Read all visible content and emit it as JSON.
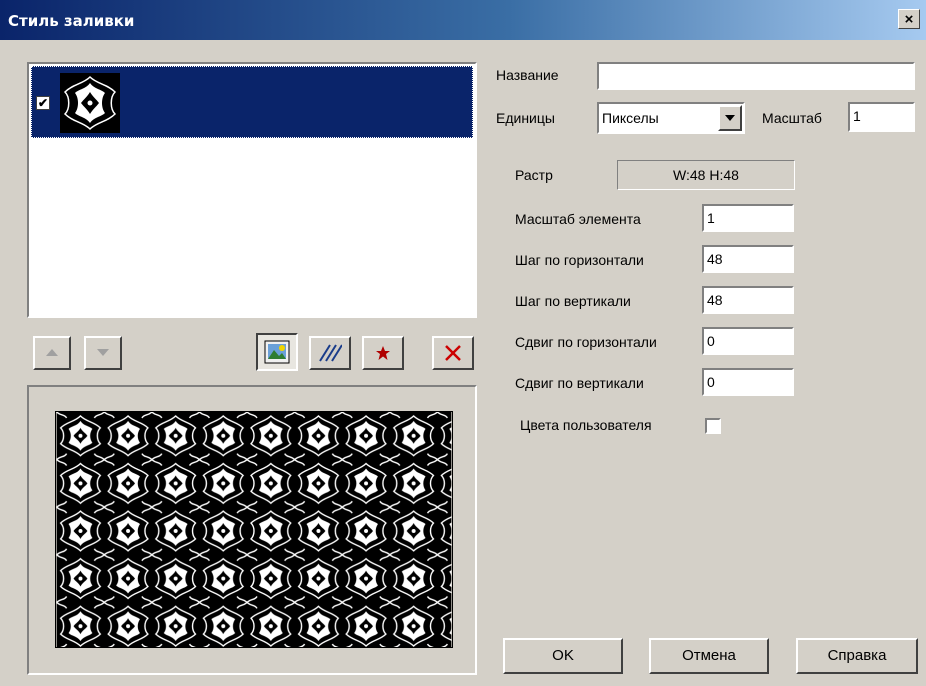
{
  "window": {
    "title": "Стиль заливки",
    "close_label": "×"
  },
  "list": {
    "items": [
      {
        "checked": true,
        "check_mark": "✔"
      }
    ]
  },
  "toolbar": {
    "up_icon": "triangle-up-icon",
    "down_icon": "triangle-down-icon",
    "image_icon": "picture-icon",
    "hatch_icon": "hatch-icon",
    "symbol_icon": "star-icon",
    "delete_icon": "red-x-icon"
  },
  "form": {
    "name_label": "Название",
    "name_value": "",
    "units_label": "Единицы",
    "units_value": "Пикселы",
    "scale_label": "Масштаб",
    "scale_value": "1",
    "raster_label": "Растр",
    "raster_value": "W:48  H:48",
    "elem_scale_label": "Масштаб элемента",
    "elem_scale_value": "1",
    "hstep_label": "Шаг по горизонтали",
    "hstep_value": "48",
    "vstep_label": "Шаг по вертикали",
    "vstep_value": "48",
    "hshift_label": "Сдвиг по горизонтали",
    "hshift_value": "0",
    "vshift_label": "Сдвиг по вертикали",
    "vshift_value": "0",
    "user_colors_label": "Цвета пользователя",
    "user_colors_checked": false
  },
  "buttons": {
    "ok": "OK",
    "cancel": "Отмена",
    "help": "Справка"
  },
  "colors": {
    "title_start": "#0a246a",
    "title_end": "#a6caf0",
    "face": "#d4d0c8",
    "delete_red": "#cc0000",
    "star_red": "#b00000"
  }
}
